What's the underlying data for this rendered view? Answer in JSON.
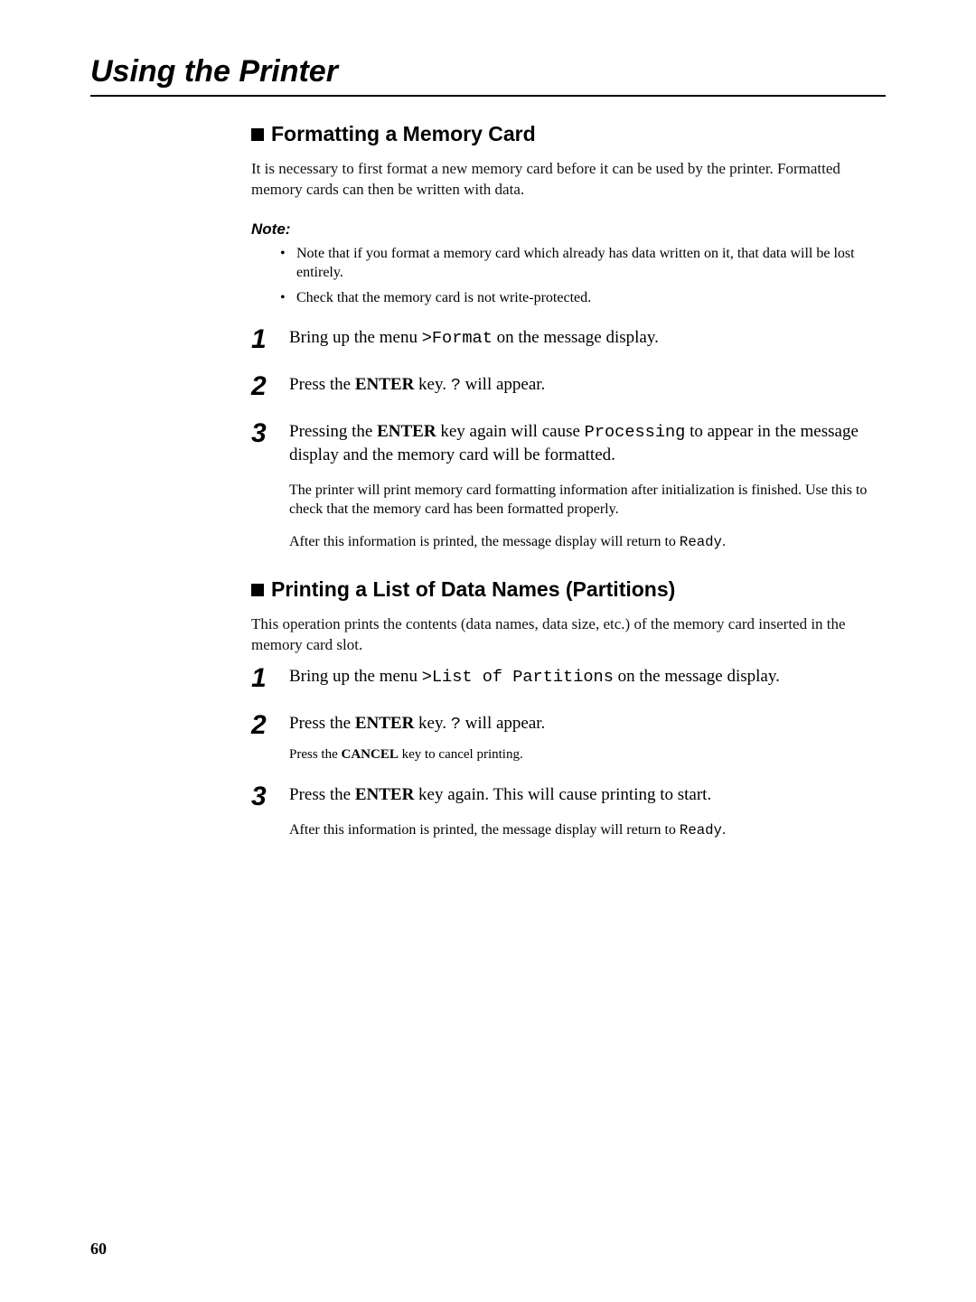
{
  "chapter_title": "Using the Printer",
  "page_number": "60",
  "section1": {
    "heading": "Formatting a Memory Card",
    "intro": "It is necessary to first format a new memory card before it can be used by the printer. Formatted memory cards can then be written with data.",
    "note_label": "Note:",
    "notes": [
      "Note that if you format a memory card which already has data written on it, that data will be lost entirely.",
      "Check that the memory card is not write-protected."
    ],
    "steps": [
      {
        "num": "1",
        "parts": {
          "pre": "Bring up the menu ",
          "mono": ">Format",
          "post": " on the message display."
        }
      },
      {
        "num": "2",
        "parts": {
          "pre": "Press the ",
          "key": "ENTER",
          "mid": " key. ",
          "mono": "?",
          "post": " will appear."
        }
      },
      {
        "num": "3",
        "parts": {
          "pre": "Pressing the ",
          "key": "ENTER",
          "mid": " key again will cause ",
          "mono": "Processing",
          "post": " to appear in the message display and the memory card will be formatted."
        },
        "sub1": "The printer will print memory card formatting information after initialization is finished.  Use this to check that the memory card has been formatted properly.",
        "sub2_pre": "After this information is printed, the message display will return to  ",
        "sub2_mono": "Ready",
        "sub2_post": "."
      }
    ]
  },
  "section2": {
    "heading": "Printing a List of Data Names (Partitions)",
    "intro": "This operation prints the contents (data names, data size, etc.) of the memory card inserted in the memory card slot.",
    "steps": [
      {
        "num": "1",
        "parts": {
          "pre": "Bring up the menu ",
          "mono": ">List of Partitions",
          "post": " on the message display."
        }
      },
      {
        "num": "2",
        "parts": {
          "pre": "Press the ",
          "key": "ENTER",
          "mid": " key. ",
          "mono": "?",
          "post": " will appear."
        },
        "sub_small_pre": " Press the ",
        "sub_small_key": " CANCEL",
        "sub_small_post": " key to cancel printing."
      },
      {
        "num": "3",
        "parts": {
          "pre": "Press the ",
          "key": "ENTER",
          "post": " key again. This will cause printing to start."
        },
        "sub_pre": "After this information is printed, the message display will return to  ",
        "sub_mono": "Ready",
        "sub_post": "."
      }
    ]
  }
}
